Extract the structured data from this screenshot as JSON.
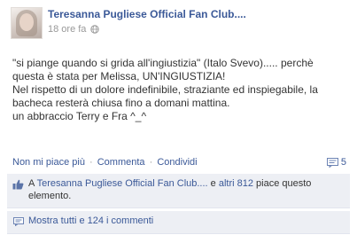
{
  "post": {
    "author": "Teresanna Pugliese Official Fan Club....",
    "timestamp": "18 ore fa",
    "message_lines": [
      "\"si piange quando si grida all'ingiustizia\" (Italo Svevo)..... perchè",
      "questa è stata per Melissa, UN'INGIUSTIZIA!",
      "Nel rispetto di un dolore indefinibile, straziante ed inspiegabile, la",
      "bacheca resterà chiusa fino a domani mattina.",
      "un abbraccio Terry e Fra ^_^"
    ]
  },
  "actions": {
    "unlike": "Non mi piace più",
    "separator": "·",
    "comment": "Commenta",
    "share": "Condividi",
    "comment_count": "5"
  },
  "likes": {
    "line1_prefix": "A ",
    "page_link": "Teresanna Pugliese Official Fan Club....",
    "and_text": " e ",
    "others_link": "altri 812",
    "suffix_line1": " piace questo",
    "line2": "elemento."
  },
  "comments": {
    "view_all": "Mostra tutti e 124 i commenti"
  },
  "colors": {
    "link": "#3b5998",
    "ufi_background": "#edeff4",
    "muted_text": "#999999"
  },
  "icons": {
    "privacy": "globe-icon",
    "comments": "comment-count-icon",
    "like": "thumbs-up-icon",
    "view_comments": "comment-bubble-icon"
  }
}
